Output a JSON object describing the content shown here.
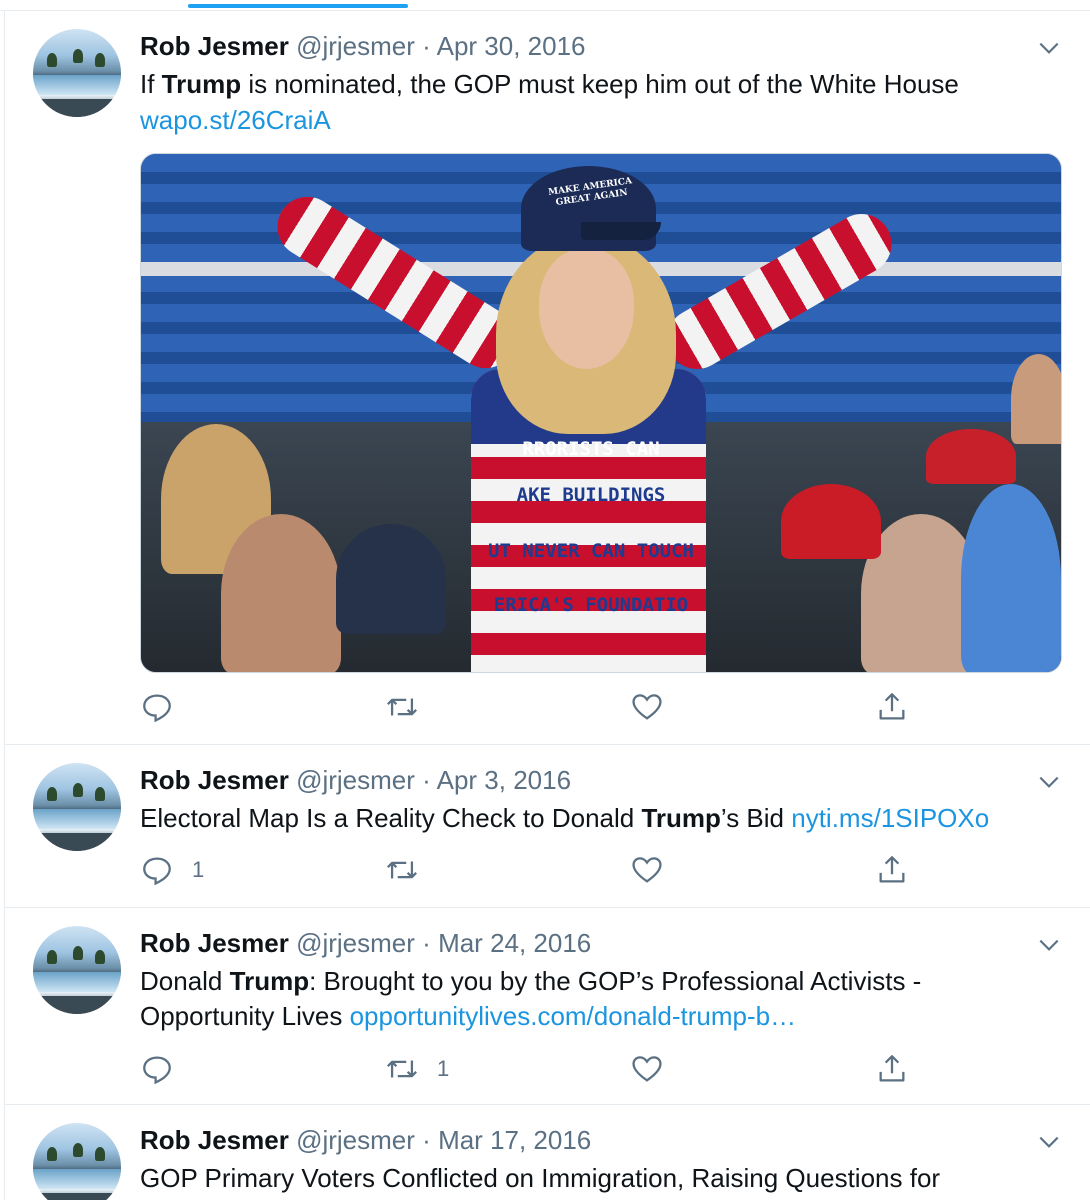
{
  "tweets": [
    {
      "name": "Rob Jesmer",
      "handle": "@jrjesmer",
      "separator": "·",
      "date": "Apr 30, 2016",
      "text_parts": [
        "If ",
        "Trump",
        " is nominated, the GOP must keep him out of the White House"
      ],
      "link": "wapo.st/26CraiA",
      "media": {
        "cap_text": "MAKE AMERICA GREAT AGAIN",
        "sweater_lines": [
          "RRORISTS CAN",
          "AKE BUILDINGS",
          "UT NEVER CAN TOUCH",
          "ERICA'S FOUNDATIO"
        ]
      },
      "reply_count": "",
      "retweet_count": "",
      "like_count": ""
    },
    {
      "name": "Rob Jesmer",
      "handle": "@jrjesmer",
      "separator": "·",
      "date": "Apr 3, 2016",
      "text_parts": [
        "Electoral Map Is a Reality Check to Donald ",
        "Trump",
        "’s Bid "
      ],
      "link": "nyti.ms/1SIPOXo",
      "reply_count": "1",
      "retweet_count": "",
      "like_count": ""
    },
    {
      "name": "Rob Jesmer",
      "handle": "@jrjesmer",
      "separator": "·",
      "date": "Mar 24, 2016",
      "text_parts": [
        "Donald ",
        "Trump",
        ": Brought to you by the GOP’s Professional Activists -"
      ],
      "text_line2": "Opportunity Lives ",
      "link": "opportunitylives.com/donald-trump-b…",
      "reply_count": "",
      "retweet_count": "1",
      "like_count": ""
    },
    {
      "name": "Rob Jesmer",
      "handle": "@jrjesmer",
      "separator": "·",
      "date": "Mar 17, 2016",
      "text_line1": "GOP Primary Voters Conflicted on Immigration, Raising Questions for"
    }
  ],
  "icons": {
    "reply": "reply-icon",
    "retweet": "retweet-icon",
    "like": "heart-icon",
    "share": "share-icon",
    "more": "chevron-down-icon"
  },
  "colors": {
    "accent": "#1da1f2",
    "link": "#1b95e0",
    "secondary_text": "#5b7083"
  }
}
